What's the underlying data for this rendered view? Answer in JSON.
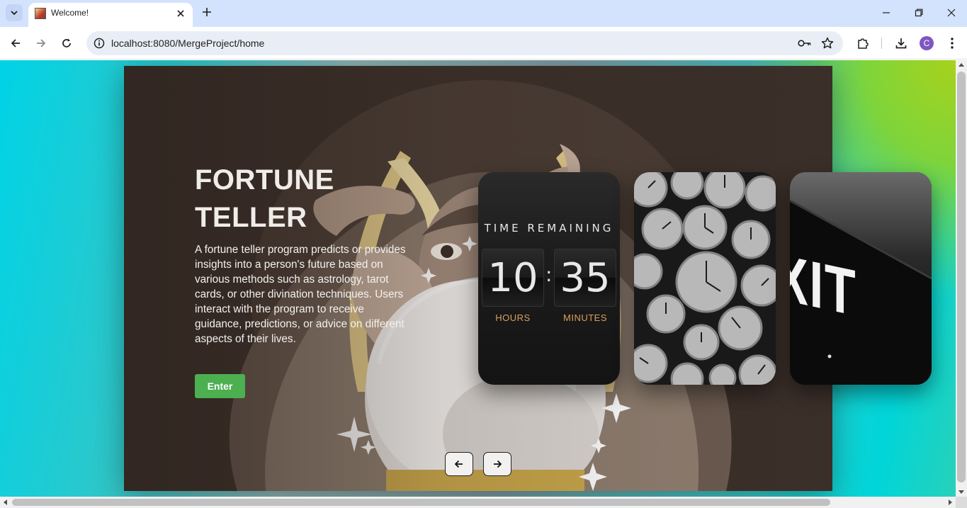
{
  "browser": {
    "tab_title": "Welcome!",
    "url": "localhost:8080/MergeProject/home",
    "profile_initial": "C",
    "icons": {
      "tab_search": "chevron-down-icon",
      "tab_close": "close-icon",
      "new_tab": "plus-icon",
      "minimize": "minimize-icon",
      "restore": "restore-icon",
      "close_window": "close-icon",
      "back": "arrow-left-icon",
      "forward": "arrow-right-icon",
      "reload": "reload-icon",
      "site_info": "info-icon",
      "password_manager": "key-icon",
      "bookmark": "star-icon",
      "extensions": "puzzle-icon",
      "downloads": "download-icon",
      "menu": "kebab-menu-icon"
    }
  },
  "hero": {
    "title": "FORTUNE TELLER",
    "description": "A fortune teller program predicts or provides insights into a person's future based on various methods such as astrology, tarot cards, or other divination techniques. Users interact with the program to receive guidance, predictions, or advice on different aspects of their lives.",
    "enter_label": "Enter",
    "nav_prev_icon": "arrow-left-icon",
    "nav_next_icon": "arrow-right-icon"
  },
  "cards": [
    {
      "name": "time-remaining",
      "heading": "TIME REMAINING",
      "hours_value": "10",
      "minutes_value": "35",
      "hours_label": "HOURS",
      "minutes_label": "MINUTES",
      "label_color": "#d6a15d"
    },
    {
      "name": "pocket-watches"
    },
    {
      "name": "exit-sign",
      "sign_text": "XIT"
    }
  ],
  "colors": {
    "enter_button": "#4caf50",
    "hero_background": "#3a2f29",
    "tab_strip": "#d3e3fd",
    "profile_avatar": "#7e57c2"
  }
}
